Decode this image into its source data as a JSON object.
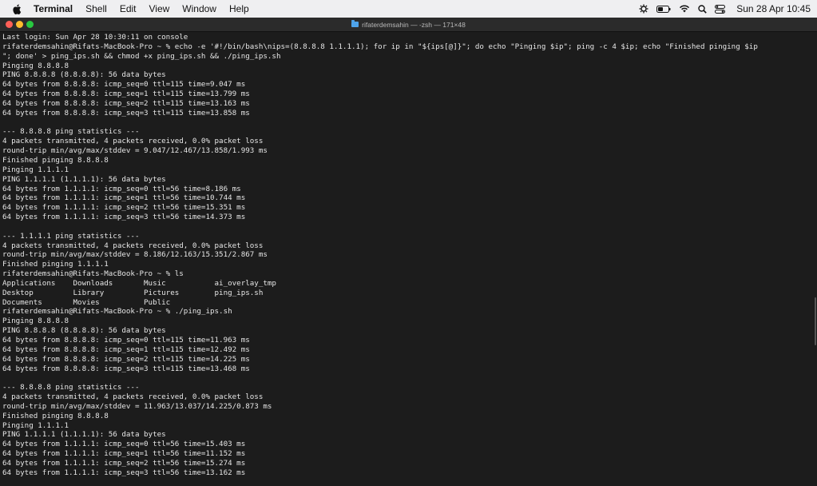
{
  "menubar": {
    "app": "Terminal",
    "items": [
      "Shell",
      "Edit",
      "View",
      "Window",
      "Help"
    ],
    "clock": "Sun 28 Apr  10:45"
  },
  "window": {
    "title": "rifaterdemsahin — -zsh — 171×48"
  },
  "terminal": {
    "lines": [
      "Last login: Sun Apr 28 10:30:11 on console",
      "rifaterdemsahin@Rifats-MacBook-Pro ~ % echo -e '#!/bin/bash\\nips=(8.8.8.8 1.1.1.1); for ip in \"${ips[@]}\"; do echo \"Pinging $ip\"; ping -c 4 $ip; echo \"Finished pinging $ip",
      "\"; done' > ping_ips.sh && chmod +x ping_ips.sh && ./ping_ips.sh",
      "Pinging 8.8.8.8",
      "PING 8.8.8.8 (8.8.8.8): 56 data bytes",
      "64 bytes from 8.8.8.8: icmp_seq=0 ttl=115 time=9.047 ms",
      "64 bytes from 8.8.8.8: icmp_seq=1 ttl=115 time=13.799 ms",
      "64 bytes from 8.8.8.8: icmp_seq=2 ttl=115 time=13.163 ms",
      "64 bytes from 8.8.8.8: icmp_seq=3 ttl=115 time=13.858 ms",
      "",
      "--- 8.8.8.8 ping statistics ---",
      "4 packets transmitted, 4 packets received, 0.0% packet loss",
      "round-trip min/avg/max/stddev = 9.047/12.467/13.858/1.993 ms",
      "Finished pinging 8.8.8.8",
      "Pinging 1.1.1.1",
      "PING 1.1.1.1 (1.1.1.1): 56 data bytes",
      "64 bytes from 1.1.1.1: icmp_seq=0 ttl=56 time=8.186 ms",
      "64 bytes from 1.1.1.1: icmp_seq=1 ttl=56 time=10.744 ms",
      "64 bytes from 1.1.1.1: icmp_seq=2 ttl=56 time=15.351 ms",
      "64 bytes from 1.1.1.1: icmp_seq=3 ttl=56 time=14.373 ms",
      "",
      "--- 1.1.1.1 ping statistics ---",
      "4 packets transmitted, 4 packets received, 0.0% packet loss",
      "round-trip min/avg/max/stddev = 8.186/12.163/15.351/2.867 ms",
      "Finished pinging 1.1.1.1",
      "rifaterdemsahin@Rifats-MacBook-Pro ~ % ls",
      "Applications    Downloads       Music           ai_overlay_tmp",
      "Desktop         Library         Pictures        ping_ips.sh",
      "Documents       Movies          Public",
      "rifaterdemsahin@Rifats-MacBook-Pro ~ % ./ping_ips.sh",
      "Pinging 8.8.8.8",
      "PING 8.8.8.8 (8.8.8.8): 56 data bytes",
      "64 bytes from 8.8.8.8: icmp_seq=0 ttl=115 time=11.963 ms",
      "64 bytes from 8.8.8.8: icmp_seq=1 ttl=115 time=12.492 ms",
      "64 bytes from 8.8.8.8: icmp_seq=2 ttl=115 time=14.225 ms",
      "64 bytes from 8.8.8.8: icmp_seq=3 ttl=115 time=13.468 ms",
      "",
      "--- 8.8.8.8 ping statistics ---",
      "4 packets transmitted, 4 packets received, 0.0% packet loss",
      "round-trip min/avg/max/stddev = 11.963/13.037/14.225/0.873 ms",
      "Finished pinging 8.8.8.8",
      "Pinging 1.1.1.1",
      "PING 1.1.1.1 (1.1.1.1): 56 data bytes",
      "64 bytes from 1.1.1.1: icmp_seq=0 ttl=56 time=15.403 ms",
      "64 bytes from 1.1.1.1: icmp_seq=1 ttl=56 time=11.152 ms",
      "64 bytes from 1.1.1.1: icmp_seq=2 ttl=56 time=15.274 ms",
      "64 bytes from 1.1.1.1: icmp_seq=3 ttl=56 time=13.162 ms"
    ]
  },
  "icons": {
    "apple": "apple-icon",
    "status": [
      "control-icon",
      "battery-icon",
      "wifi-icon",
      "search-icon",
      "control-center-icon"
    ]
  },
  "colors": {
    "terminal_bg": "#1c1c1c",
    "terminal_fg": "#e6e6e6",
    "menubar_bg": "#efeff1",
    "close": "#ff5f57",
    "minimize": "#febc2e",
    "maximize": "#28c840"
  }
}
